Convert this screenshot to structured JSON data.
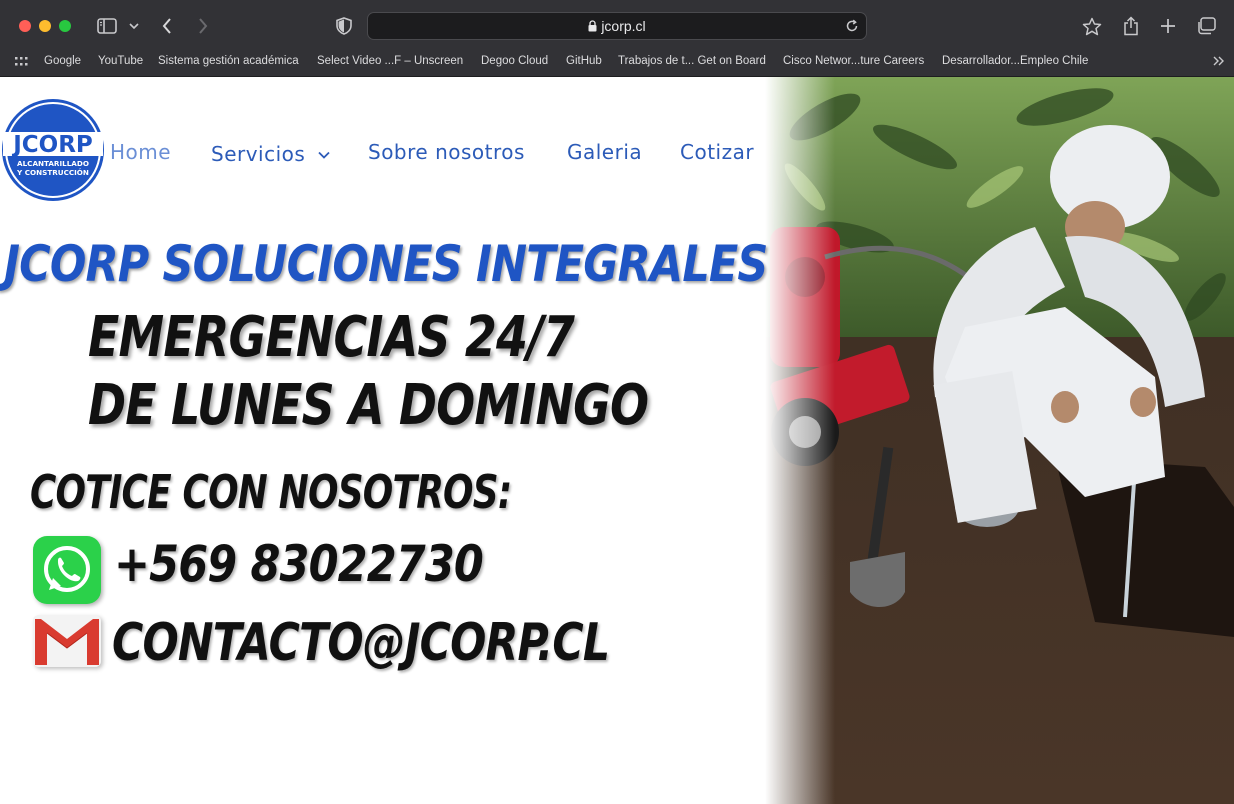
{
  "browser": {
    "url": "jcorp.cl",
    "bookmarks": [
      "Google",
      "YouTube",
      "Sistema gestión académica",
      "Select Video ...F – Unscreen",
      "Degoo Cloud",
      "GitHub",
      "Trabajos de t... Get on Board",
      "Cisco Networ...ture Careers",
      "Desarrollador...Empleo Chile"
    ],
    "icons": [
      "sidebar-icon",
      "chevron-down-icon",
      "back-icon",
      "forward-icon",
      "shield-icon",
      "lock-icon",
      "reload-icon",
      "star-icon",
      "share-icon",
      "plus-icon",
      "tabs-icon",
      "grid-icon",
      "double-chevron-icon"
    ]
  },
  "site": {
    "logo": {
      "name": "JCORP",
      "line1": "ALCANTARILLADO",
      "line2": "Y CONSTRUCCIÓN",
      "color": "#1f55c4"
    },
    "nav": [
      "Home",
      "Servicios",
      "Sobre nosotros",
      "Galeria",
      "Cotizar"
    ],
    "banner": {
      "title": "JCORP SOLUCIONES INTEGRALES",
      "line1": "EMERGENCIAS 24/7",
      "line2": "DE LUNES A DOMINGO",
      "cta": "COTICE CON NOSOTROS:",
      "phone": "+569 83022730",
      "email": "CONTACTO@JCORP.CL"
    }
  }
}
